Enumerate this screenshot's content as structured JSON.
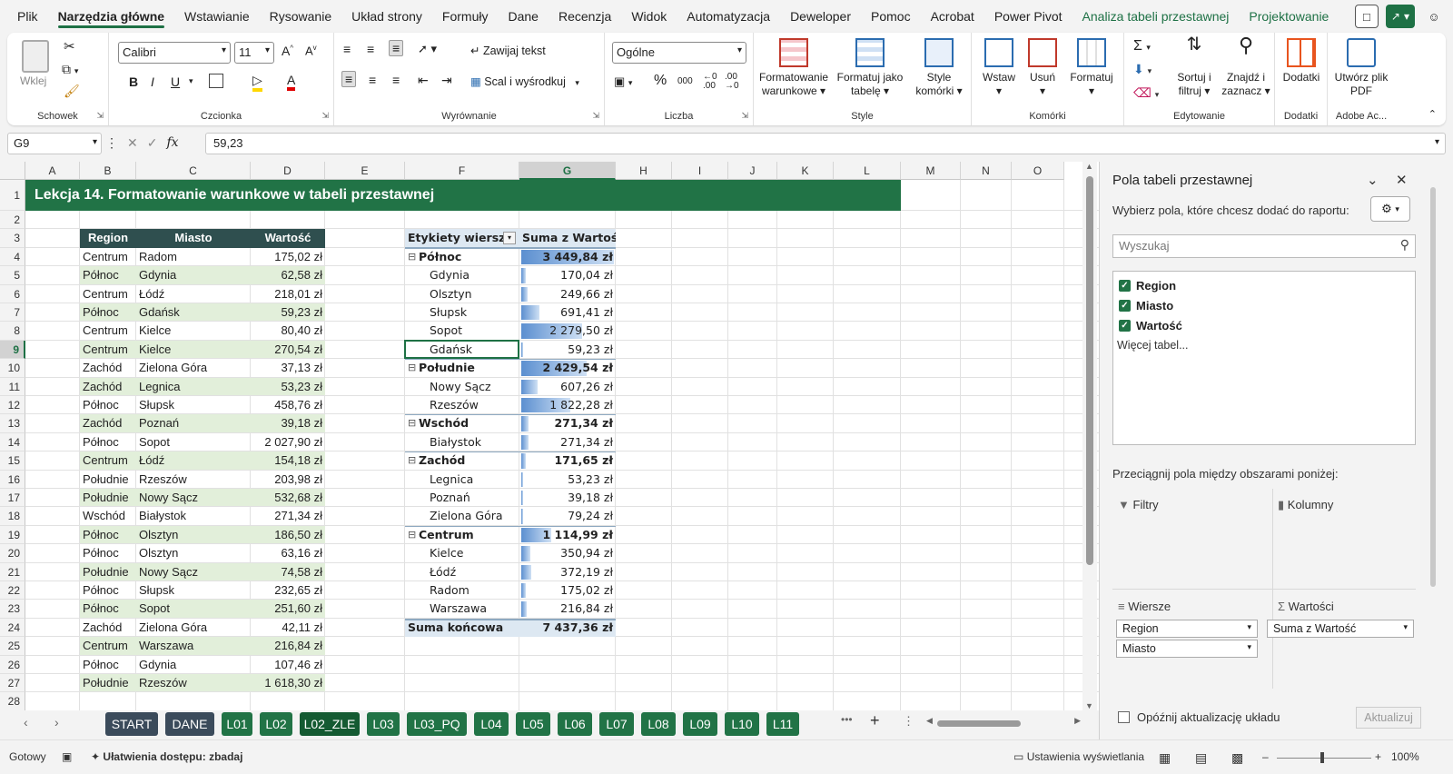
{
  "menu": {
    "tabs": [
      "Plik",
      "Narzędzia główne",
      "Wstawianie",
      "Rysowanie",
      "Układ strony",
      "Formuły",
      "Dane",
      "Recenzja",
      "Widok",
      "Automatyzacja",
      "Deweloper",
      "Pomoc",
      "Acrobat",
      "Power Pivot",
      "Analiza tabeli przestawnej",
      "Projektowanie"
    ],
    "active": "Narzędzia główne"
  },
  "ribbon": {
    "clipboard": {
      "paste": "Wklej",
      "name": "Schowek"
    },
    "font": {
      "family": "Calibri",
      "size": "11",
      "bold": "B",
      "italic": "I",
      "underline": "U",
      "name": "Czcionka"
    },
    "alignment": {
      "wrap": "Zawijaj tekst",
      "merge": "Scal i wyśrodkuj",
      "name": "Wyrównanie"
    },
    "number": {
      "format": "Ogólne",
      "percent": "%",
      "thousands": "000",
      "name": "Liczba"
    },
    "styles": {
      "cond": "Formatowanie warunkowe",
      "astable": "Formatuj jako tabelę",
      "cellstyles": "Style komórki",
      "name": "Style"
    },
    "cells": {
      "insert": "Wstaw",
      "delete": "Usuń",
      "format": "Formatuj",
      "name": "Komórki"
    },
    "editing": {
      "sortfilter": "Sortuj i filtruj",
      "findselect": "Znajdź i zaznacz",
      "name": "Edytowanie"
    },
    "addins": {
      "label": "Dodatki",
      "name": "Dodatki"
    },
    "adobe": {
      "label": "Utwórz plik PDF",
      "name": "Adobe Ac..."
    }
  },
  "formula": {
    "cell": "G9",
    "value": "59,23",
    "fx": "fx"
  },
  "columns": [
    "A",
    "B",
    "C",
    "D",
    "E",
    "F",
    "G",
    "H",
    "I",
    "J",
    "K",
    "L",
    "M",
    "N",
    "O"
  ],
  "rows": [
    "1",
    "2",
    "3",
    "4",
    "5",
    "6",
    "7",
    "8",
    "9",
    "10",
    "11",
    "12",
    "13",
    "14",
    "15",
    "16",
    "17",
    "18",
    "19",
    "20",
    "21",
    "22",
    "23",
    "24",
    "25",
    "26",
    "27",
    "28"
  ],
  "sheet_title": "Lekcja 14. Formatowanie warunkowe w tabeli przestawnej",
  "data_table": {
    "headers": [
      "Region",
      "Miasto",
      "Wartość"
    ],
    "rows": [
      [
        "Centrum",
        "Radom",
        "175,02 zł"
      ],
      [
        "Północ",
        "Gdynia",
        "62,58 zł"
      ],
      [
        "Centrum",
        "Łódź",
        "218,01 zł"
      ],
      [
        "Północ",
        "Gdańsk",
        "59,23 zł"
      ],
      [
        "Centrum",
        "Kielce",
        "80,40 zł"
      ],
      [
        "Centrum",
        "Kielce",
        "270,54 zł"
      ],
      [
        "Zachód",
        "Zielona Góra",
        "37,13 zł"
      ],
      [
        "Zachód",
        "Legnica",
        "53,23 zł"
      ],
      [
        "Północ",
        "Słupsk",
        "458,76 zł"
      ],
      [
        "Zachód",
        "Poznań",
        "39,18 zł"
      ],
      [
        "Północ",
        "Sopot",
        "2 027,90 zł"
      ],
      [
        "Centrum",
        "Łódź",
        "154,18 zł"
      ],
      [
        "Południe",
        "Rzeszów",
        "203,98 zł"
      ],
      [
        "Południe",
        "Nowy Sącz",
        "532,68 zł"
      ],
      [
        "Wschód",
        "Białystok",
        "271,34 zł"
      ],
      [
        "Północ",
        "Olsztyn",
        "186,50 zł"
      ],
      [
        "Północ",
        "Olsztyn",
        "63,16 zł"
      ],
      [
        "Południe",
        "Nowy Sącz",
        "74,58 zł"
      ],
      [
        "Północ",
        "Słupsk",
        "232,65 zł"
      ],
      [
        "Północ",
        "Sopot",
        "251,60 zł"
      ],
      [
        "Zachód",
        "Zielona Góra",
        "42,11 zł"
      ],
      [
        "Centrum",
        "Warszawa",
        "216,84 zł"
      ],
      [
        "Północ",
        "Gdynia",
        "107,46 zł"
      ],
      [
        "Południe",
        "Rzeszów",
        "1 618,30 zł"
      ]
    ]
  },
  "pivot": {
    "header_label": "Etykiety wierszy",
    "header_value": "Suma z Wartość",
    "rows": [
      {
        "label": "Północ",
        "value": "3 449,84 zł",
        "level": 0,
        "amount": 3449.84
      },
      {
        "label": "Gdynia",
        "value": "170,04 zł",
        "level": 1,
        "amount": 170.04
      },
      {
        "label": "Olsztyn",
        "value": "249,66 zł",
        "level": 1,
        "amount": 249.66
      },
      {
        "label": "Słupsk",
        "value": "691,41 zł",
        "level": 1,
        "amount": 691.41
      },
      {
        "label": "Sopot",
        "value": "2 279,50 zł",
        "level": 1,
        "amount": 2279.5
      },
      {
        "label": "Gdańsk",
        "value": "59,23 zł",
        "level": 1,
        "amount": 59.23
      },
      {
        "label": "Południe",
        "value": "2 429,54 zł",
        "level": 0,
        "amount": 2429.54
      },
      {
        "label": "Nowy Sącz",
        "value": "607,26 zł",
        "level": 1,
        "amount": 607.26
      },
      {
        "label": "Rzeszów",
        "value": "1 822,28 zł",
        "level": 1,
        "amount": 1822.28
      },
      {
        "label": "Wschód",
        "value": "271,34 zł",
        "level": 0,
        "amount": 271.34
      },
      {
        "label": "Białystok",
        "value": "271,34 zł",
        "level": 1,
        "amount": 271.34
      },
      {
        "label": "Zachód",
        "value": "171,65 zł",
        "level": 0,
        "amount": 171.65
      },
      {
        "label": "Legnica",
        "value": "53,23 zł",
        "level": 1,
        "amount": 53.23
      },
      {
        "label": "Poznań",
        "value": "39,18 zł",
        "level": 1,
        "amount": 39.18
      },
      {
        "label": "Zielona Góra",
        "value": "79,24 zł",
        "level": 1,
        "amount": 79.24
      },
      {
        "label": "Centrum",
        "value": "1 114,99 zł",
        "level": 0,
        "amount": 1114.99
      },
      {
        "label": "Kielce",
        "value": "350,94 zł",
        "level": 1,
        "amount": 350.94
      },
      {
        "label": "Łódź",
        "value": "372,19 zł",
        "level": 1,
        "amount": 372.19
      },
      {
        "label": "Radom",
        "value": "175,02 zł",
        "level": 1,
        "amount": 175.02
      },
      {
        "label": "Warszawa",
        "value": "216,84 zł",
        "level": 1,
        "amount": 216.84
      }
    ],
    "total_label": "Suma końcowa",
    "total_value": "7 437,36 zł",
    "bar_max": 3449.84
  },
  "sheets": {
    "tabs": [
      "START",
      "DANE",
      "L01",
      "L02",
      "L02_ZLE",
      "L03",
      "L03_PQ",
      "L04",
      "L05",
      "L06",
      "L07",
      "L08",
      "L09",
      "L10",
      "L11"
    ],
    "selected": "L02_ZLE",
    "more": "•••",
    "add": "+"
  },
  "status": {
    "ready": "Gotowy",
    "accessibility": "Ułatwienia dostępu: zbadaj",
    "display": "Ustawienia wyświetlania",
    "zoom": "100%"
  },
  "panel": {
    "title": "Pola tabeli przestawnej",
    "subtitle": "Wybierz pola, które chcesz dodać do raportu:",
    "search_placeholder": "Wyszukaj",
    "fields": [
      "Region",
      "Miasto",
      "Wartość"
    ],
    "more_tables": "Więcej tabel...",
    "drag_hint": "Przeciągnij pola między obszarami poniżej:",
    "filters": "Filtry",
    "columns": "Kolumny",
    "rows_label": "Wiersze",
    "values": "Wartości",
    "row_fields": [
      "Region",
      "Miasto"
    ],
    "value_fields": [
      "Suma z Wartość"
    ],
    "defer": "Opóźnij aktualizację układu",
    "update": "Aktualizuj"
  },
  "colors": {
    "accent": "#217346",
    "header_dark": "#2f4f4f",
    "band": "#e2efda",
    "pivot_header": "#dde8f2",
    "databar": "#5b8fd0"
  }
}
